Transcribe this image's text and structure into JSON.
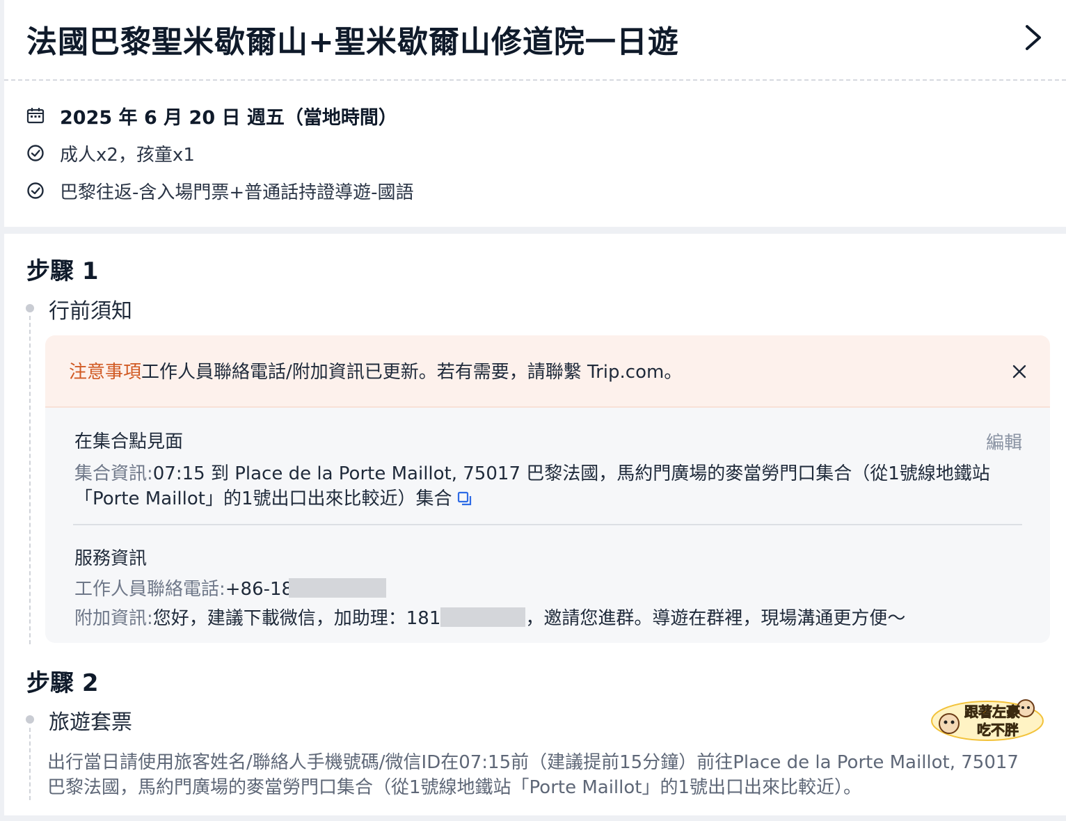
{
  "header": {
    "title": "法國巴黎聖米歇爾山+聖米歇爾山修道院一日遊"
  },
  "summary": {
    "date": "2025 年 6 月 20 日 週五（當地時間）",
    "pax": "成人x2，孩童x1",
    "package": "巴黎往返-含入場門票+普通話持證導遊-國語"
  },
  "step1": {
    "title": "步驟 1",
    "subtitle": "行前須知",
    "notice": {
      "highlight": "注意事項",
      "text": "工作人員聯絡電話/附加資訊已更新。若有需要，請聯繫 Trip.com。"
    },
    "meeting": {
      "heading": "在集合點見面",
      "edit_label": "編輯",
      "info_label": "集合資訊:",
      "info_line1": "07:15 到 Place de la Porte Maillot, 75017 巴黎法國，馬約門廣場的麥當勞門口集合（從1號線地鐵站",
      "info_line2": "「Porte Maillot」的1號出口出來比較近）集合"
    },
    "service": {
      "heading": "服務資訊",
      "phone_label": "工作人員聯絡電話:",
      "phone_value": "+86-18",
      "extra_label": "附加資訊:",
      "extra_value_start": "您好，建議下載微信，加助理：181",
      "extra_value_end": "，邀請您進群。導遊在群裡，現場溝通更方便～"
    }
  },
  "step2": {
    "title": "步驟 2",
    "subtitle": "旅遊套票",
    "desc_line1": "出行當日請使用旅客姓名/聯絡人手機號碼/微信ID在07:15前（建議提前15分鐘）前往Place de la Porte Maillot, 75017",
    "desc_line2": "巴黎法國，馬約門廣場的麥當勞門口集合（從1號線地鐵站「Porte Maillot」的1號出口出來比較近）。",
    "watermark": "跟著左豪吃不胖"
  },
  "colors": {
    "accent_orange": "#d15a24",
    "link_blue": "#2e6be6",
    "notice_bg": "#fdf1ec"
  }
}
